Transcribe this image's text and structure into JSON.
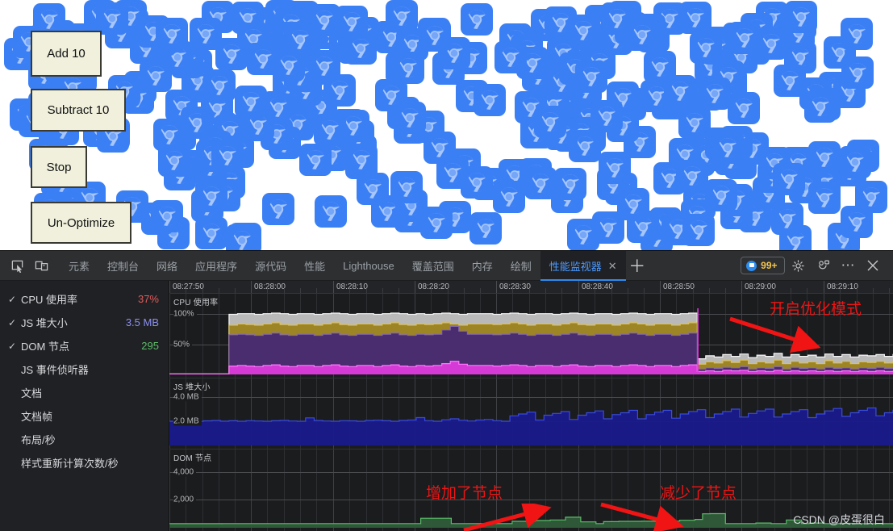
{
  "viewport": {
    "buttons": [
      {
        "id": "add",
        "label": "Add 10"
      },
      {
        "id": "subtract",
        "label": "Subtract 10"
      },
      {
        "id": "stop",
        "label": "Stop"
      },
      {
        "id": "unopt",
        "label": "Un-Optimize"
      }
    ],
    "icon_name": "chrome-logo-icon",
    "icon_color": "#3b7ff5",
    "background": "#ffffff",
    "sprite_count": 295
  },
  "devtools": {
    "toolbar": {
      "inspect_icon": "inspect-element-icon",
      "device_icon": "device-toolbar-icon",
      "tabs": [
        {
          "label": "元素",
          "active": false
        },
        {
          "label": "控制台",
          "active": false
        },
        {
          "label": "网络",
          "active": false
        },
        {
          "label": "应用程序",
          "active": false
        },
        {
          "label": "源代码",
          "active": false
        },
        {
          "label": "性能",
          "active": false
        },
        {
          "label": "Lighthouse",
          "active": false
        },
        {
          "label": "覆盖范围",
          "active": false
        },
        {
          "label": "内存",
          "active": false
        },
        {
          "label": "绘制",
          "active": false
        },
        {
          "label": "性能监视器",
          "active": true
        }
      ],
      "tab_close_glyph": "✕",
      "more_tabs_glyph": "＋",
      "issues_count": "99+",
      "settings_icon": "gear-icon",
      "customize_icon": "devtools-settings-icon",
      "more_icon": "more-options-icon",
      "close_icon": "close-icon",
      "accent_color": "#2d8cf0",
      "issues_count_color": "#f3c64b"
    },
    "metrics": [
      {
        "label": "CPU 使用率",
        "value": "37%",
        "value_color": "#e05c5c",
        "checked": true
      },
      {
        "label": "JS 堆大小",
        "value": "3.5 MB",
        "value_color": "#8c90f0",
        "checked": true
      },
      {
        "label": "DOM 节点",
        "value": "295",
        "value_color": "#5bbd68",
        "checked": true
      },
      {
        "label": "JS 事件侦听器",
        "value": "",
        "value_color": "",
        "checked": false
      },
      {
        "label": "文档",
        "value": "",
        "value_color": "",
        "checked": false
      },
      {
        "label": "文档帧",
        "value": "",
        "value_color": "",
        "checked": false
      },
      {
        "label": "布局/秒",
        "value": "",
        "value_color": "",
        "checked": false
      },
      {
        "label": "样式重新计算次数/秒",
        "value": "",
        "value_color": "",
        "checked": false
      }
    ],
    "annotations": [
      {
        "id": "opt-mode",
        "text": "开启优化模式",
        "color": "#f01414"
      },
      {
        "id": "added-nodes",
        "text": "增加了节点",
        "color": "#f01414"
      },
      {
        "id": "removed-nodes",
        "text": "减少了节点",
        "color": "#f01414"
      }
    ],
    "watermark": "CSDN @皮蛋很白"
  },
  "chart_data": [
    {
      "id": "cpu",
      "type": "area",
      "title": "CPU 使用率",
      "ylabel": "",
      "xlabel": "",
      "ylim": [
        0,
        110
      ],
      "ytick_labels": [
        "100%",
        "50%"
      ],
      "ytick_values": [
        100,
        50
      ],
      "grid": true,
      "legend": "none",
      "x_ticks": [
        "08:27:50",
        "08:28:00",
        "08:28:10",
        "08:28:20",
        "08:28:30",
        "08:28:40",
        "08:28:50",
        "08:29:00",
        "08:29:10"
      ],
      "xlim_seconds": [
        507670,
        507755
      ],
      "series": [
        {
          "name": "total",
          "color": "#b9b9b9",
          "values": [
            1,
            1,
            1,
            1,
            1,
            1,
            1,
            100,
            101,
            101,
            100,
            101,
            102,
            101,
            100,
            101,
            101,
            100,
            101,
            102,
            101,
            100,
            101,
            101,
            100,
            101,
            102,
            101,
            100,
            101,
            100,
            101,
            102,
            101,
            100,
            101,
            101,
            101,
            100,
            101,
            102,
            101,
            100,
            101,
            101,
            100,
            101,
            102,
            101,
            100,
            101,
            101,
            100,
            101,
            102,
            101,
            100,
            101,
            101,
            100,
            101,
            102,
            26,
            31,
            29,
            33,
            30,
            34,
            28,
            32,
            30,
            35,
            29,
            33,
            30,
            32,
            29,
            34,
            30,
            33,
            29,
            32,
            31,
            33,
            30,
            34
          ]
        },
        {
          "name": "script",
          "color": "#9d8526",
          "values": [
            1,
            1,
            1,
            1,
            1,
            1,
            1,
            82,
            84,
            83,
            82,
            84,
            86,
            83,
            82,
            84,
            84,
            82,
            84,
            86,
            83,
            82,
            84,
            84,
            82,
            84,
            86,
            83,
            82,
            84,
            83,
            84,
            86,
            84,
            82,
            84,
            84,
            84,
            83,
            84,
            86,
            84,
            82,
            84,
            84,
            82,
            84,
            86,
            83,
            82,
            84,
            84,
            82,
            84,
            86,
            84,
            82,
            84,
            84,
            82,
            84,
            86,
            17,
            21,
            19,
            23,
            20,
            24,
            18,
            21,
            19,
            24,
            18,
            22,
            19,
            21,
            18,
            23,
            19,
            22,
            18,
            21,
            20,
            22,
            19,
            23
          ]
        },
        {
          "name": "render",
          "color": "#4a2d6e",
          "values": [
            1,
            1,
            1,
            1,
            1,
            1,
            1,
            66,
            67,
            66,
            65,
            67,
            69,
            66,
            65,
            67,
            67,
            65,
            67,
            69,
            66,
            65,
            67,
            67,
            65,
            67,
            69,
            66,
            65,
            67,
            66,
            67,
            74,
            80,
            72,
            67,
            67,
            67,
            66,
            67,
            69,
            67,
            65,
            67,
            67,
            65,
            67,
            69,
            66,
            65,
            67,
            67,
            65,
            67,
            69,
            67,
            65,
            67,
            67,
            65,
            67,
            69,
            9,
            11,
            10,
            12,
            11,
            13,
            9,
            11,
            10,
            13,
            9,
            12,
            10,
            11,
            9,
            12,
            10,
            11,
            9,
            11,
            10,
            12,
            10,
            12
          ]
        },
        {
          "name": "idle",
          "color": "#d63ad6",
          "values": [
            1,
            1,
            1,
            1,
            1,
            1,
            1,
            14,
            15,
            14,
            13,
            15,
            16,
            14,
            13,
            15,
            15,
            13,
            15,
            16,
            14,
            13,
            15,
            15,
            13,
            15,
            16,
            14,
            13,
            15,
            14,
            15,
            18,
            22,
            17,
            15,
            15,
            15,
            14,
            15,
            16,
            15,
            13,
            15,
            15,
            13,
            15,
            16,
            14,
            13,
            15,
            15,
            13,
            15,
            16,
            15,
            13,
            15,
            15,
            13,
            15,
            16,
            5,
            6,
            5,
            7,
            6,
            7,
            5,
            6,
            5,
            7,
            5,
            6,
            5,
            6,
            5,
            6,
            5,
            6,
            5,
            6,
            5,
            6,
            5,
            6
          ]
        }
      ],
      "marker": {
        "x_index": 62,
        "color": "#e635e6",
        "label": "optimization-enabled"
      }
    },
    {
      "id": "js-heap",
      "type": "area",
      "title": "JS 堆大小",
      "ylim": [
        0,
        4.6
      ],
      "ytick_labels": [
        "4.0 MB",
        "2.0 MB"
      ],
      "ytick_values": [
        4.0,
        2.0
      ],
      "unit": "MB",
      "grid": true,
      "series": [
        {
          "name": "heap",
          "color": "#1a1a8c",
          "line_color": "#3a4be0",
          "values": [
            2.0,
            2.02,
            2.05,
            2.0,
            2.03,
            2.06,
            2.01,
            2.04,
            2.0,
            2.05,
            2.02,
            2.0,
            2.04,
            2.07,
            2.02,
            2.0,
            2.28,
            2.06,
            2.02,
            2.0,
            2.05,
            2.03,
            2.0,
            2.06,
            2.09,
            2.04,
            2.0,
            2.07,
            2.1,
            2.3,
            2.05,
            2.0,
            2.12,
            2.2,
            2.08,
            2.02,
            2.1,
            2.15,
            2.05,
            2.0,
            2.45,
            2.6,
            2.75,
            2.1,
            2.5,
            2.65,
            2.8,
            2.15,
            2.5,
            2.7,
            2.85,
            2.2,
            2.55,
            2.7,
            2.9,
            2.2,
            2.55,
            2.75,
            2.9,
            2.25,
            2.6,
            2.8,
            2.95,
            2.3,
            2.6,
            2.8,
            3.0,
            2.35,
            2.65,
            2.85,
            3.0,
            2.35,
            2.6,
            2.8,
            2.95,
            2.3,
            2.6,
            2.85,
            3.05,
            2.4,
            2.7,
            2.9,
            3.1,
            2.45,
            2.7,
            2.95
          ]
        }
      ]
    },
    {
      "id": "dom-nodes",
      "type": "area",
      "title": "DOM 节点",
      "ylim": [
        0,
        4800
      ],
      "ytick_labels": [
        "4,000",
        "2,000"
      ],
      "ytick_values": [
        4000,
        2000
      ],
      "grid": true,
      "series": [
        {
          "name": "nodes",
          "color": "#2f5c3a",
          "line_color": "#5bbd68",
          "values": [
            295,
            295,
            295,
            295,
            295,
            295,
            295,
            300,
            300,
            300,
            300,
            300,
            300,
            300,
            300,
            300,
            300,
            300,
            300,
            300,
            300,
            300,
            300,
            300,
            300,
            300,
            300,
            300,
            300,
            300,
            300,
            300,
            300,
            680,
            680,
            680,
            680,
            300,
            300,
            300,
            300,
            300,
            300,
            300,
            300,
            460,
            460,
            460,
            520,
            520,
            560,
            560,
            760,
            760,
            420,
            420,
            300,
            440,
            440,
            460,
            460,
            460,
            470,
            470,
            470,
            480,
            480,
            540,
            540,
            600,
            1000,
            1010,
            1010,
            300,
            300,
            300,
            300,
            340,
            340,
            300,
            300,
            560,
            560,
            300,
            340,
            340,
            300,
            300,
            320,
            320,
            300,
            295,
            295,
            295,
            295,
            295
          ]
        }
      ]
    }
  ]
}
